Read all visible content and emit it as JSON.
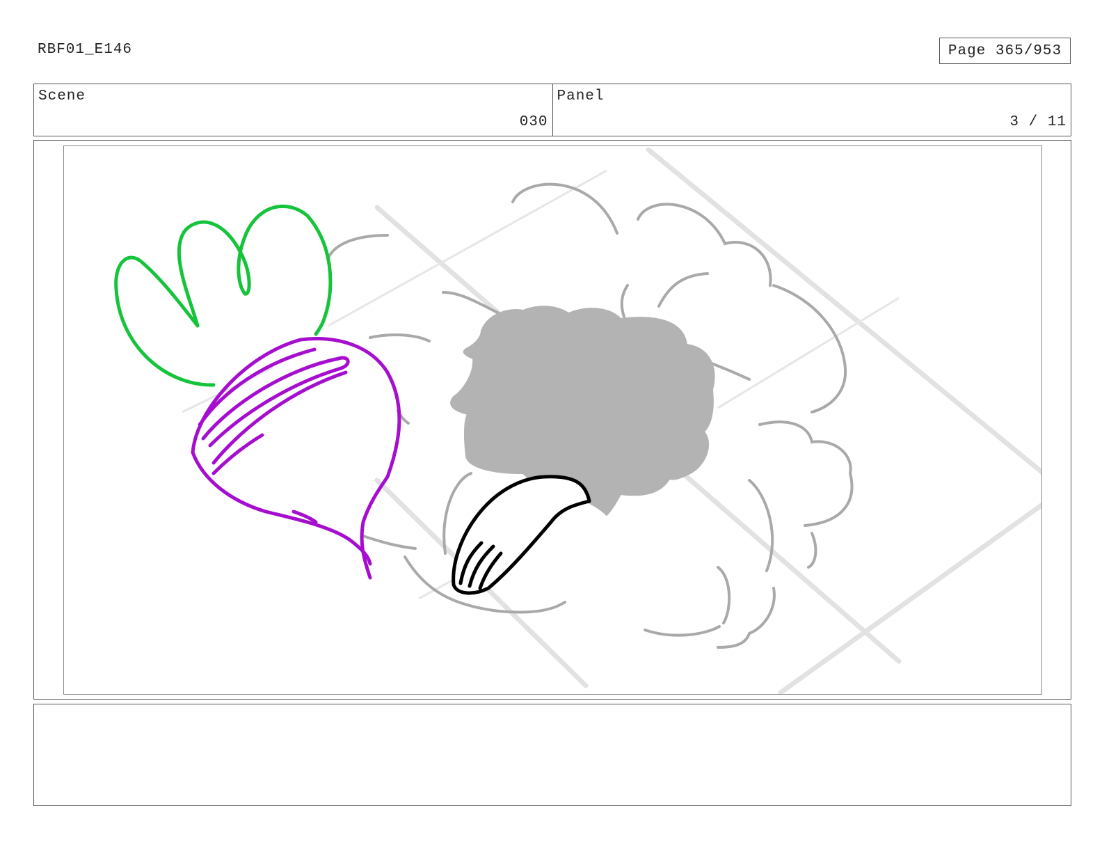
{
  "header": {
    "doc_id": "RBF01_E146",
    "page_label": "Page 365/953"
  },
  "info": {
    "scene_label": "Scene",
    "scene_value": "030",
    "panel_label": "Panel",
    "panel_value": "3 / 11"
  },
  "notes": {
    "text": ""
  },
  "colors": {
    "leaf": "#16c43c",
    "radish": "#a60ecf",
    "smoke": "#a9a9a9",
    "hole": "#b3b3b3",
    "tongue": "#000000",
    "floor": "#e0e0e0"
  }
}
